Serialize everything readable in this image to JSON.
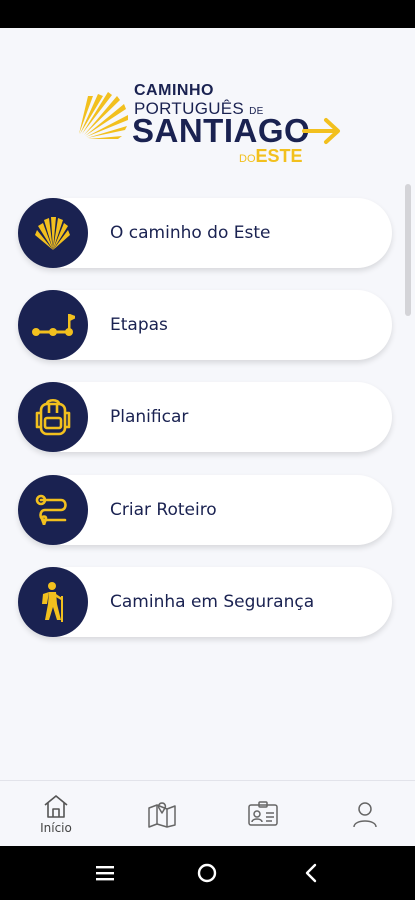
{
  "logo": {
    "line1": "CAMINHO",
    "line2": "PORTUGUÊS",
    "line2_suffix": "DE",
    "line3": "SANTIAGO",
    "line4_prefix": "DO",
    "line4": "ESTE"
  },
  "menu": {
    "items": [
      {
        "label": "O caminho do Este",
        "icon": "scallop-shell-icon"
      },
      {
        "label": "Etapas",
        "icon": "route-stages-icon"
      },
      {
        "label": "Planificar",
        "icon": "backpack-icon"
      },
      {
        "label": "Criar Roteiro",
        "icon": "route-path-icon"
      },
      {
        "label": "Caminha em Segurança",
        "icon": "hiker-icon"
      }
    ]
  },
  "bottom_nav": {
    "items": [
      {
        "label": "Início",
        "icon": "home-icon",
        "active": true
      },
      {
        "label": "",
        "icon": "map-icon",
        "active": false
      },
      {
        "label": "",
        "icon": "credential-card-icon",
        "active": false
      },
      {
        "label": "",
        "icon": "profile-icon",
        "active": false
      }
    ]
  },
  "colors": {
    "navy": "#1a2251",
    "gold": "#f2c01e",
    "background": "#f6f7fb"
  }
}
